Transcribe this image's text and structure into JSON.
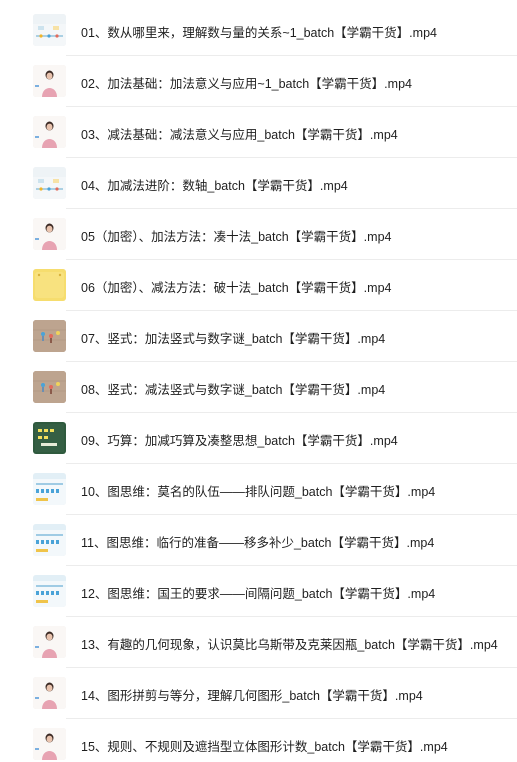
{
  "files": [
    {
      "name": "01、数从哪里来，理解数与量的关系~1_batch【学霸干货】.mp4",
      "thumb": "number-line-thumbnail"
    },
    {
      "name": "02、加法基础：加法意义与应用~1_batch【学霸干货】.mp4",
      "thumb": "teacher-thumbnail"
    },
    {
      "name": "03、减法基础：减法意义与应用_batch【学霸干货】.mp4",
      "thumb": "teacher-thumbnail"
    },
    {
      "name": "04、加减法进阶：数轴_batch【学霸干货】.mp4",
      "thumb": "number-line-thumbnail"
    },
    {
      "name": "05（加密）、加法方法：凑十法_batch【学霸干货】.mp4",
      "thumb": "teacher-thumbnail"
    },
    {
      "name": "06（加密）、减法方法：破十法_batch【学霸干货】.mp4",
      "thumb": "yellow-slide-thumbnail"
    },
    {
      "name": "07、竖式：加法竖式与数字谜_batch【学霸干货】.mp4",
      "thumb": "floor-figures-thumbnail"
    },
    {
      "name": "08、竖式：减法竖式与数字谜_batch【学霸干货】.mp4",
      "thumb": "floor-figures-thumbnail"
    },
    {
      "name": "09、巧算：加减巧算及凑整思想_batch【学霸干货】.mp4",
      "thumb": "chalkboard-thumbnail"
    },
    {
      "name": "10、图思维：莫名的队伍——排队问题_batch【学霸干货】.mp4",
      "thumb": "diagram-thumbnail"
    },
    {
      "name": "11、图思维：临行的准备——移多补少_batch【学霸干货】.mp4",
      "thumb": "diagram-thumbnail"
    },
    {
      "name": "12、图思维：国王的要求——间隔问题_batch【学霸干货】.mp4",
      "thumb": "diagram-thumbnail"
    },
    {
      "name": "13、有趣的几何现象，认识莫比乌斯带及克莱因瓶_batch【学霸干货】.mp4",
      "thumb": "teacher-thumbnail"
    },
    {
      "name": "14、图形拼剪与等分，理解几何图形_batch【学霸干货】.mp4",
      "thumb": "teacher-thumbnail"
    },
    {
      "name": "15、规则、不规则及遮挡型立体图形计数_batch【学霸干货】.mp4",
      "thumb": "teacher-thumbnail"
    }
  ]
}
